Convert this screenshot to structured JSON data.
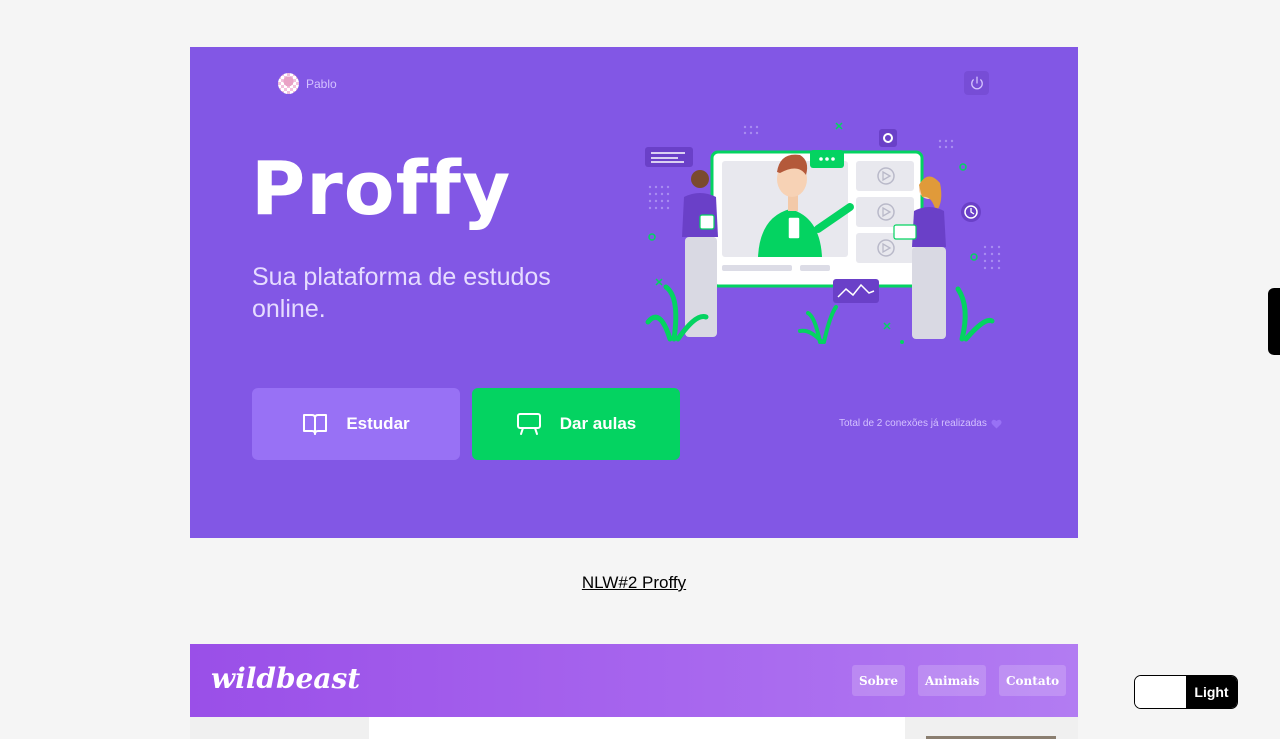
{
  "proffy": {
    "user_name": "Pablo",
    "brand": "Proffy",
    "tagline": "Sua plataforma de estudos online.",
    "study_label": "Estudar",
    "teach_label": "Dar aulas",
    "connections_text": "Total de 2 conexões já realizadas",
    "colors": {
      "background": "#8257e5",
      "study": "#9871f5",
      "teach": "#04d361"
    }
  },
  "project_link": "NLW#2 Proffy",
  "wildbeast": {
    "logo": "wildbeast",
    "nav": [
      "Sobre",
      "Animais",
      "Contato"
    ]
  },
  "theme_toggle": {
    "label": "Light"
  }
}
